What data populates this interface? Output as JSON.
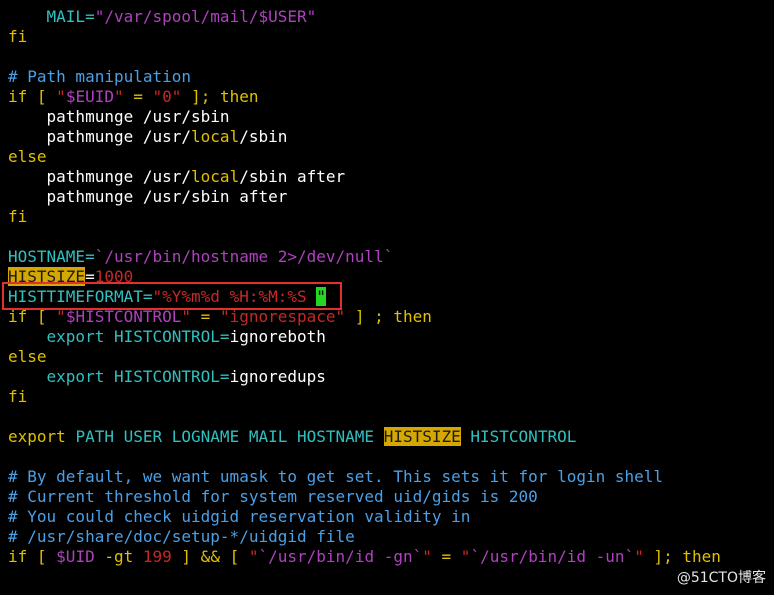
{
  "colors": {
    "bg": "#000000",
    "text": "#ffffff",
    "keyword": "#e0c000",
    "comment": "#4aa0e8",
    "string": "#c62828",
    "variable": "#b040c0",
    "cyan_var": "#30c0c0",
    "highlight_bg": "#d4a800",
    "highlight_fg": "#1a1a1a",
    "cursor_bg": "#22d822",
    "box": "#e03131"
  },
  "lines": [
    [
      {
        "t": "    MAIL=",
        "c": "cyan_var"
      },
      {
        "t": "\"/var/spool/mail/$USER\"",
        "c": "variable"
      }
    ],
    [
      {
        "t": "fi",
        "c": "keyword"
      }
    ],
    [],
    [
      {
        "t": "# Path manipulation",
        "c": "comment"
      }
    ],
    [
      {
        "t": "if [ ",
        "c": "keyword"
      },
      {
        "t": "\"",
        "c": "string"
      },
      {
        "t": "$EUID",
        "c": "variable"
      },
      {
        "t": "\"",
        "c": "string"
      },
      {
        "t": " = ",
        "c": "keyword"
      },
      {
        "t": "\"0\"",
        "c": "string"
      },
      {
        "t": " ]; then",
        "c": "keyword"
      }
    ],
    [
      {
        "t": "    pathmunge /usr/sbin",
        "c": "text"
      }
    ],
    [
      {
        "t": "    pathmunge /usr/",
        "c": "text"
      },
      {
        "t": "local",
        "c": "keyword"
      },
      {
        "t": "/sbin",
        "c": "text"
      }
    ],
    [
      {
        "t": "else",
        "c": "keyword"
      }
    ],
    [
      {
        "t": "    pathmunge /usr/",
        "c": "text"
      },
      {
        "t": "local",
        "c": "keyword"
      },
      {
        "t": "/sbin after",
        "c": "text"
      }
    ],
    [
      {
        "t": "    pathmunge /usr/sbin after",
        "c": "text"
      }
    ],
    [
      {
        "t": "fi",
        "c": "keyword"
      }
    ],
    [],
    [
      {
        "t": "HOSTNAME=",
        "c": "cyan_var"
      },
      {
        "t": "`/usr/bin/hostname 2>/dev/null`",
        "c": "variable"
      }
    ],
    [
      {
        "t": "HISTSIZE",
        "c": "highlight"
      },
      {
        "t": "=",
        "c": "text"
      },
      {
        "t": "1000",
        "c": "string"
      }
    ],
    [
      {
        "t": "HISTTIMEFORMAT=",
        "c": "cyan_var"
      },
      {
        "t": "\"",
        "c": "string"
      },
      {
        "t": "%Y%m%d %H:%M:%S ",
        "c": "string"
      },
      {
        "t": "\"",
        "c": "cursor"
      }
    ],
    [
      {
        "t": "if [ ",
        "c": "keyword"
      },
      {
        "t": "\"",
        "c": "string"
      },
      {
        "t": "$HISTCONTROL",
        "c": "variable"
      },
      {
        "t": "\"",
        "c": "string"
      },
      {
        "t": " = ",
        "c": "keyword"
      },
      {
        "t": "\"ignorespace\"",
        "c": "string"
      },
      {
        "t": " ] ; then",
        "c": "keyword"
      }
    ],
    [
      {
        "t": "    export HISTCONTROL=",
        "c": "cyan_var"
      },
      {
        "t": "ignoreboth",
        "c": "text"
      }
    ],
    [
      {
        "t": "else",
        "c": "keyword"
      }
    ],
    [
      {
        "t": "    export HISTCONTROL=",
        "c": "cyan_var"
      },
      {
        "t": "ignoredups",
        "c": "text"
      }
    ],
    [
      {
        "t": "fi",
        "c": "keyword"
      }
    ],
    [],
    [
      {
        "t": "export ",
        "c": "keyword"
      },
      {
        "t": "PATH USER LOGNAME MAIL HOSTNAME ",
        "c": "cyan_var"
      },
      {
        "t": "HISTSIZE",
        "c": "highlight"
      },
      {
        "t": " HISTCONTROL",
        "c": "cyan_var"
      }
    ],
    [],
    [
      {
        "t": "# By default, we want umask to get set. This sets it for login shell",
        "c": "comment"
      }
    ],
    [
      {
        "t": "# Current threshold for system reserved uid/gids is 200",
        "c": "comment"
      }
    ],
    [
      {
        "t": "# You could check uidgid reservation validity in",
        "c": "comment"
      }
    ],
    [
      {
        "t": "# /usr/share/doc/setup-*/uidgid file",
        "c": "comment"
      }
    ],
    [
      {
        "t": "if [ ",
        "c": "keyword"
      },
      {
        "t": "$UID",
        "c": "variable"
      },
      {
        "t": " -gt ",
        "c": "keyword"
      },
      {
        "t": "199",
        "c": "string"
      },
      {
        "t": " ] && [ ",
        "c": "keyword"
      },
      {
        "t": "\"",
        "c": "string"
      },
      {
        "t": "`/usr/bin/id -gn`",
        "c": "variable"
      },
      {
        "t": "\"",
        "c": "string"
      },
      {
        "t": " = ",
        "c": "keyword"
      },
      {
        "t": "\"",
        "c": "string"
      },
      {
        "t": "`/usr/bin/id -un`",
        "c": "variable"
      },
      {
        "t": "\"",
        "c": "string"
      },
      {
        "t": " ]; then",
        "c": "keyword"
      }
    ]
  ],
  "watermark": "@51CTO博客"
}
